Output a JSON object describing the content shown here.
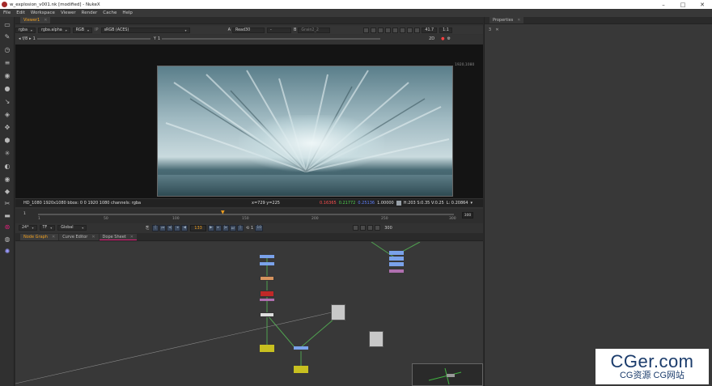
{
  "window": {
    "title": "w_explosion_v001.nk [modified] - NukeX",
    "minimize": "–",
    "maximize": "□",
    "close": "✕"
  },
  "menu": [
    "File",
    "Edit",
    "Workspace",
    "Viewer",
    "Render",
    "Cache",
    "Help"
  ],
  "viewer": {
    "tab_label": "Viewer1",
    "channels": "rgba",
    "alpha_channel": "rgba.alpha",
    "display": "RGB",
    "colorspace_prefix": "IP",
    "colorspace": "sRGB (ACES)",
    "input_a_label": "A",
    "input_a": "Read30",
    "input_a_dash": "-",
    "input_b_label": "B",
    "input_b": "Grain2_2",
    "zoom": "41.7",
    "ratio": "1:1",
    "fstop": "f/8",
    "gain": "1",
    "y_label": "Y",
    "y_value": "1",
    "view_mode": "2D",
    "format_label": "1920,1080",
    "info_left": "HD_1080 1920x1080  bbox: 0 0 1920 1080 channels: rgba",
    "coords": "x=729 y=225",
    "pix_r": "0.16365",
    "pix_g": "0.21772",
    "pix_b": "0.25136",
    "pix_a": "1.00000",
    "hsv": "H:203 S:0.35 V:0.25",
    "lum": "L: 0.20864"
  },
  "timeline": {
    "start": "1",
    "end": "300",
    "ticks": [
      "1",
      "50",
      "100",
      "150",
      "200",
      "250",
      "300"
    ],
    "current_frame": "133",
    "fps": "24*",
    "tf": "TF",
    "scope": "Global",
    "step": "1",
    "step_val": "10",
    "end_frame": "300"
  },
  "nodegraph": {
    "tabs": [
      "Node Graph",
      "Curve Editor",
      "Dope Sheet"
    ]
  },
  "properties": {
    "tab_label": "Properties"
  },
  "watermark": {
    "line1": "CGer.com",
    "line2": "CG资源 CG网站"
  }
}
